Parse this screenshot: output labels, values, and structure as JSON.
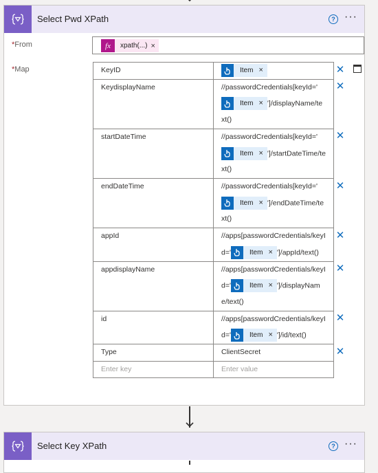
{
  "card1": {
    "title": "Select Pwd XPath",
    "help_glyph": "?",
    "more_glyph": "···",
    "from_label": "From",
    "required_mark": "*",
    "from_token": {
      "label": "xpath(...)",
      "icon": "fx",
      "remove": "×"
    },
    "map_label": "Map",
    "rows": [
      {
        "key": "KeyID",
        "segments": [
          {
            "token": "Item"
          }
        ]
      },
      {
        "key": "KeydisplayName",
        "segments": [
          {
            "text": "//passwordCredentials[keyId='"
          },
          {
            "token": "Item"
          },
          {
            "text": "']/displayName/text()"
          }
        ]
      },
      {
        "key": "startDateTime",
        "segments": [
          {
            "text": "//passwordCredentials[keyId='"
          },
          {
            "token": "Item"
          },
          {
            "text": "']/startDateTime/text()"
          }
        ]
      },
      {
        "key": "endDateTime",
        "segments": [
          {
            "text": "//passwordCredentials[keyId='"
          },
          {
            "token": "Item"
          },
          {
            "text": "']/endDateTime/text()"
          }
        ]
      },
      {
        "key": "appId",
        "segments": [
          {
            "text": "//apps[passwordCredentials/keyId='"
          },
          {
            "token": "Item"
          },
          {
            "text": "']/appId/text()"
          }
        ]
      },
      {
        "key": "appdisplayName",
        "segments": [
          {
            "text": "//apps[passwordCredentials/keyId='"
          },
          {
            "token": "Item"
          },
          {
            "text": "']/displayName/text()"
          }
        ]
      },
      {
        "key": "id",
        "segments": [
          {
            "text": "//apps[passwordCredentials/keyId='"
          },
          {
            "token": "Item"
          },
          {
            "text": "']/id/text()"
          }
        ]
      },
      {
        "key": "Type",
        "segments": [
          {
            "text": "ClientSecret"
          }
        ]
      }
    ],
    "new_row": {
      "key_placeholder": "Enter key",
      "value_placeholder": "Enter value"
    },
    "remove_glyph": "✕"
  },
  "card2": {
    "title": "Select Key XPath",
    "help_glyph": "?",
    "more_glyph": "···"
  },
  "token_remove_glyph": "×",
  "colors": {
    "action_icon": "#7a5fc6",
    "header_bg": "#ece8f7",
    "token_bg": "#e1eefa",
    "token_icon": "#0f6cbd",
    "expr_icon": "#b0178b",
    "expr_bg": "#fbe6f3"
  },
  "icons": {
    "action": "data-operation-icon",
    "token": "manual-trigger-icon",
    "delete": "close-icon",
    "switch": "text-mode-icon"
  }
}
